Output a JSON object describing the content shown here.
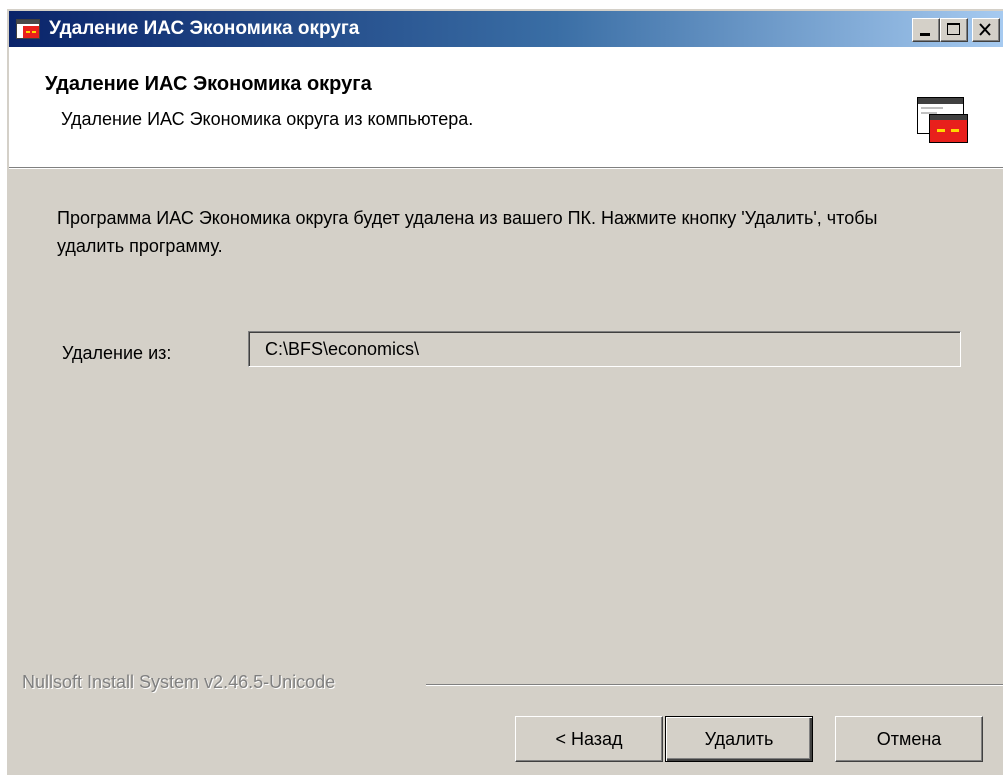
{
  "window": {
    "title": "Удаление ИАС Экономика округа"
  },
  "header": {
    "title": "Удаление ИАС Экономика округа",
    "subtitle": "Удаление ИАС Экономика округа из компьютера."
  },
  "body": {
    "description": "Программа ИАС Экономика округа будет удалена из вашего ПК. Нажмите кнопку 'Удалить', чтобы удалить программу.",
    "uninstall_from_label": "Удаление из:",
    "uninstall_path": "C:\\BFS\\economics\\"
  },
  "branding": {
    "text": "Nullsoft Install System v2.46.5-Unicode"
  },
  "buttons": {
    "back": "< Назад",
    "uninstall": "Удалить",
    "cancel": "Отмена"
  },
  "icons": {
    "title": "installer-app-icon",
    "header": "uninstall-window-icon",
    "minimize": "minimize-icon",
    "maximize": "maximize-icon",
    "close": "close-icon"
  },
  "colors": {
    "titlebar_start": "#0a246a",
    "titlebar_end": "#a6caf0",
    "face": "#d4d0c8",
    "icon_red": "#e8201c"
  }
}
